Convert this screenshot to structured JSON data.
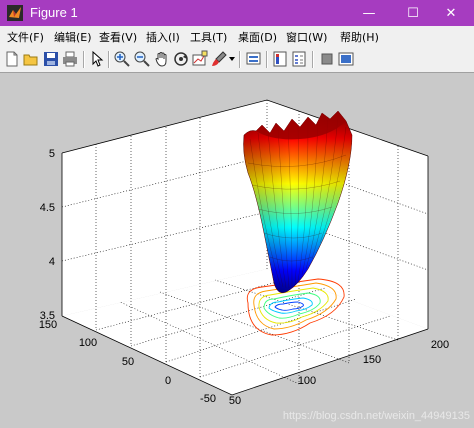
{
  "window": {
    "title": "Figure 1",
    "minimize_symbol": "—",
    "maximize_symbol": "☐",
    "close_symbol": "✕"
  },
  "menu": {
    "items": [
      {
        "label": "文件(F)"
      },
      {
        "label": "编辑(E)"
      },
      {
        "label": "查看(V)"
      },
      {
        "label": "插入(I)"
      },
      {
        "label": "工具(T)"
      },
      {
        "label": "桌面(D)"
      },
      {
        "label": "窗口(W)"
      },
      {
        "label": "帮助(H)"
      }
    ]
  },
  "toolbar": {
    "buttons": [
      {
        "icon": "new-figure-icon"
      },
      {
        "icon": "open-file-icon"
      },
      {
        "icon": "save-icon"
      },
      {
        "icon": "print-icon"
      },
      {
        "icon": "pointer-icon"
      },
      {
        "icon": "zoom-in-icon"
      },
      {
        "icon": "zoom-out-icon"
      },
      {
        "icon": "pan-icon"
      },
      {
        "icon": "rotate-3d-icon"
      },
      {
        "icon": "data-cursor-icon"
      },
      {
        "icon": "brush-icon"
      },
      {
        "icon": "link-plot-icon"
      },
      {
        "icon": "insert-colorbar-icon"
      },
      {
        "icon": "insert-legend-icon"
      },
      {
        "icon": "hide-plot-tools-icon"
      },
      {
        "icon": "show-plot-tools-icon"
      }
    ]
  },
  "chart_data": {
    "type": "surface3d",
    "z_ticks": [
      "3.5",
      "4",
      "4.5",
      "5"
    ],
    "y_ticks": [
      "-50",
      "0",
      "50",
      "100",
      "150"
    ],
    "x_ticks": [
      "50",
      "100",
      "150",
      "200"
    ],
    "zlim": [
      3.5,
      5
    ],
    "grid": true,
    "colormap": [
      "#00008f",
      "#0000ff",
      "#00ffff",
      "#ffff00",
      "#ff0000",
      "#800000"
    ],
    "contour_projection": true
  },
  "watermark": "https://blog.csdn.net/weixin_44949135"
}
